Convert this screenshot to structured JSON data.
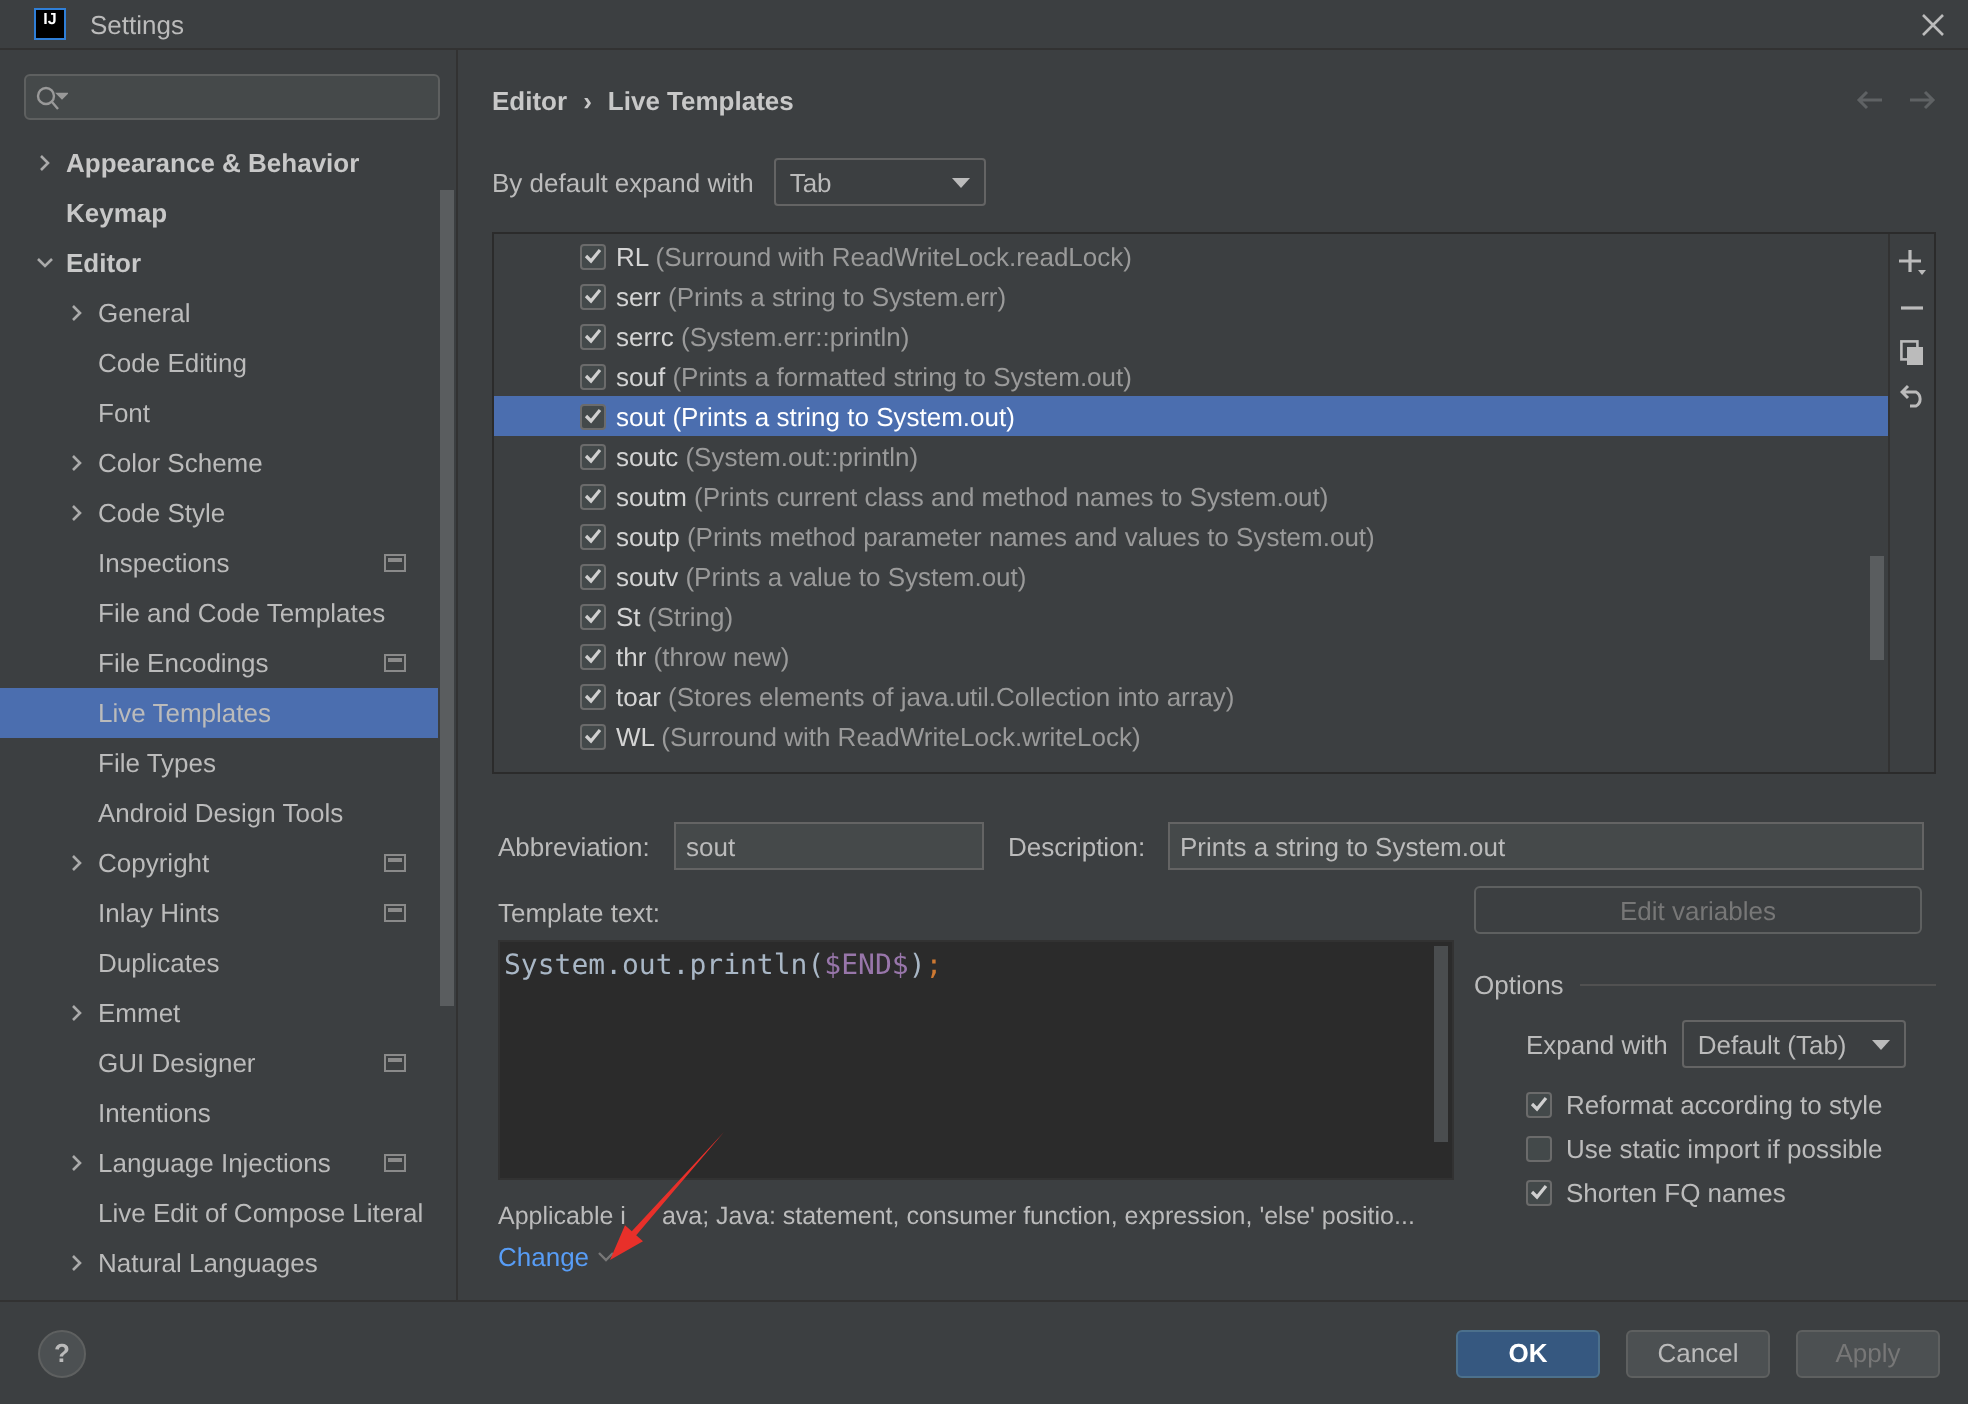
{
  "window": {
    "title": "Settings",
    "logo_text": "IJ"
  },
  "sidebar": {
    "items": [
      {
        "label": "Appearance & Behavior",
        "kind": "group",
        "expanded": false,
        "selected": false,
        "badge": false
      },
      {
        "label": "Keymap",
        "kind": "leaf",
        "selected": false,
        "badge": false
      },
      {
        "label": "Editor",
        "kind": "group",
        "expanded": true,
        "selected": false,
        "badge": false,
        "children": [
          {
            "label": "General",
            "kind": "group",
            "expanded": false,
            "selected": false,
            "badge": false
          },
          {
            "label": "Code Editing",
            "kind": "leaf",
            "selected": false,
            "badge": false
          },
          {
            "label": "Font",
            "kind": "leaf",
            "selected": false,
            "badge": false
          },
          {
            "label": "Color Scheme",
            "kind": "group",
            "expanded": false,
            "selected": false,
            "badge": false
          },
          {
            "label": "Code Style",
            "kind": "group",
            "expanded": false,
            "selected": false,
            "badge": false
          },
          {
            "label": "Inspections",
            "kind": "leaf",
            "selected": false,
            "badge": true
          },
          {
            "label": "File and Code Templates",
            "kind": "leaf",
            "selected": false,
            "badge": false
          },
          {
            "label": "File Encodings",
            "kind": "leaf",
            "selected": false,
            "badge": true
          },
          {
            "label": "Live Templates",
            "kind": "leaf",
            "selected": true,
            "badge": false
          },
          {
            "label": "File Types",
            "kind": "leaf",
            "selected": false,
            "badge": false
          },
          {
            "label": "Android Design Tools",
            "kind": "leaf",
            "selected": false,
            "badge": false
          },
          {
            "label": "Copyright",
            "kind": "group",
            "expanded": false,
            "selected": false,
            "badge": true
          },
          {
            "label": "Inlay Hints",
            "kind": "leaf",
            "selected": false,
            "badge": true
          },
          {
            "label": "Duplicates",
            "kind": "leaf",
            "selected": false,
            "badge": false
          },
          {
            "label": "Emmet",
            "kind": "group",
            "expanded": false,
            "selected": false,
            "badge": false
          },
          {
            "label": "GUI Designer",
            "kind": "leaf",
            "selected": false,
            "badge": true
          },
          {
            "label": "Intentions",
            "kind": "leaf",
            "selected": false,
            "badge": false
          },
          {
            "label": "Language Injections",
            "kind": "group",
            "expanded": false,
            "selected": false,
            "badge": true
          },
          {
            "label": "Live Edit of Compose Literal",
            "kind": "leaf",
            "selected": false,
            "badge": false
          },
          {
            "label": "Natural Languages",
            "kind": "group",
            "expanded": false,
            "selected": false,
            "badge": false
          }
        ]
      }
    ]
  },
  "breadcrumb": [
    "Editor",
    "›",
    "Live Templates"
  ],
  "expand_default": {
    "label": "By default expand with",
    "value": "Tab"
  },
  "templates": [
    {
      "abbreviation": "RL",
      "description": "(Surround with ReadWriteLock.readLock)",
      "checked": true,
      "selected": false
    },
    {
      "abbreviation": "serr",
      "description": "(Prints a string to System.err)",
      "checked": true,
      "selected": false
    },
    {
      "abbreviation": "serrc",
      "description": "(System.err::println)",
      "checked": true,
      "selected": false
    },
    {
      "abbreviation": "souf",
      "description": "(Prints a formatted string to System.out)",
      "checked": true,
      "selected": false
    },
    {
      "abbreviation": "sout",
      "description": "(Prints a string to System.out)",
      "checked": true,
      "selected": true
    },
    {
      "abbreviation": "soutc",
      "description": "(System.out::println)",
      "checked": true,
      "selected": false
    },
    {
      "abbreviation": "soutm",
      "description": "(Prints current class and method names to System.out)",
      "checked": true,
      "selected": false
    },
    {
      "abbreviation": "soutp",
      "description": "(Prints method parameter names and values to System.out)",
      "checked": true,
      "selected": false
    },
    {
      "abbreviation": "soutv",
      "description": "(Prints a value to System.out)",
      "checked": true,
      "selected": false
    },
    {
      "abbreviation": "St",
      "description": "(String)",
      "checked": true,
      "selected": false
    },
    {
      "abbreviation": "thr",
      "description": "(throw new)",
      "checked": true,
      "selected": false
    },
    {
      "abbreviation": "toar",
      "description": "(Stores elements of java.util.Collection into array)",
      "checked": true,
      "selected": false
    },
    {
      "abbreviation": "WL",
      "description": "(Surround with ReadWriteLock.writeLock)",
      "checked": true,
      "selected": false
    }
  ],
  "abbreviation": {
    "label": "Abbreviation:",
    "value": "sout"
  },
  "description": {
    "label": "Description:",
    "value": "Prints a string to System.out"
  },
  "template_text": {
    "label": "Template text:",
    "segments": [
      {
        "text": "System.out.println(",
        "kind": "plain"
      },
      {
        "text": "$END$",
        "kind": "variable"
      },
      {
        "text": ")",
        "kind": "plain"
      },
      {
        "text": ";",
        "kind": "semicolon"
      }
    ]
  },
  "applicable": [
    "Applicable i",
    "ava; Java: statement, consumer function, expression, 'else' positio..."
  ],
  "change_link": "Change",
  "edit_variables": {
    "label": "Edit variables",
    "disabled": true
  },
  "options": {
    "title": "Options",
    "expand_with": {
      "label": "Expand with",
      "value": "Default (Tab)"
    },
    "checkboxes": [
      {
        "label": "Reformat according to style",
        "checked": true
      },
      {
        "label": "Use static import if possible",
        "checked": false
      },
      {
        "label": "Shorten FQ names",
        "checked": true
      }
    ]
  },
  "buttons": [
    {
      "label": "OK",
      "kind": "primary",
      "disabled": false
    },
    {
      "label": "Cancel",
      "kind": "normal",
      "disabled": false
    },
    {
      "label": "Apply",
      "kind": "normal",
      "disabled": true
    }
  ],
  "help": "?"
}
